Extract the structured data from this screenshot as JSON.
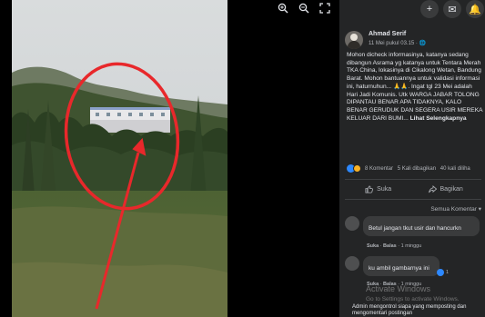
{
  "viewer": {
    "tools": [
      {
        "name": "zoom-in-icon"
      },
      {
        "name": "zoom-out-icon"
      },
      {
        "name": "fullscreen-icon"
      }
    ]
  },
  "header": {
    "icons": [
      {
        "name": "add-icon",
        "glyph": "+"
      },
      {
        "name": "messenger-icon",
        "glyph": "✉"
      },
      {
        "name": "notifications-icon",
        "glyph": "🔔"
      }
    ]
  },
  "post": {
    "author": "Ahmad Serif",
    "time": "11 Mei pukul 03.15 · 🌐",
    "text": "Mohon dicheck informasinya, katanya sedang dibangun Asrama yg katanya untuk Tentara Merah TKA China, lokasinya di Cikalong Wetan, Bandung Barat. Mohon bantuannya untuk validasi informasi ini, haturnuhun... 🙏🙏. Ingat tgl 23 Mei adalah Hari Jadi Komunis. Utk WARGA JABAR TOLONG DIPANTAU BENAR APA TIDAKNYA, KALO BENAR GERUDUK DAN SEGERA USIR MEREKA KELUAR DARI BUMI...",
    "see_more": "Lihat Selengkapnya",
    "stats": {
      "comments": "8 Komentar",
      "shares": "5 Kali dibagikan",
      "views": "40 kali diliha"
    },
    "actions": {
      "like": "Suka",
      "share": "Bagikan"
    },
    "sort_label": "Semua Komentar ▾"
  },
  "comments": [
    {
      "text": "Betul jangan tkut usir dan hancurkn",
      "meta_like": "Suka",
      "meta_reply": "Balas",
      "meta_time": "1 minggu",
      "count": ""
    },
    {
      "text": "ku ambil gambarnya ini",
      "meta_like": "Suka",
      "meta_reply": "Balas",
      "meta_time": "1 minggu",
      "count": "1"
    }
  ],
  "watermark": {
    "title": "Activate Windows",
    "subtitle": "Go to Settings to activate Windows."
  },
  "footer": {
    "text": "Admin mengontrol siapa yang memposting dan mengomentari postingan"
  },
  "colors": {
    "panel_bg": "#242526",
    "annotation_red": "#e8282b",
    "like_blue": "#2d88ff"
  }
}
